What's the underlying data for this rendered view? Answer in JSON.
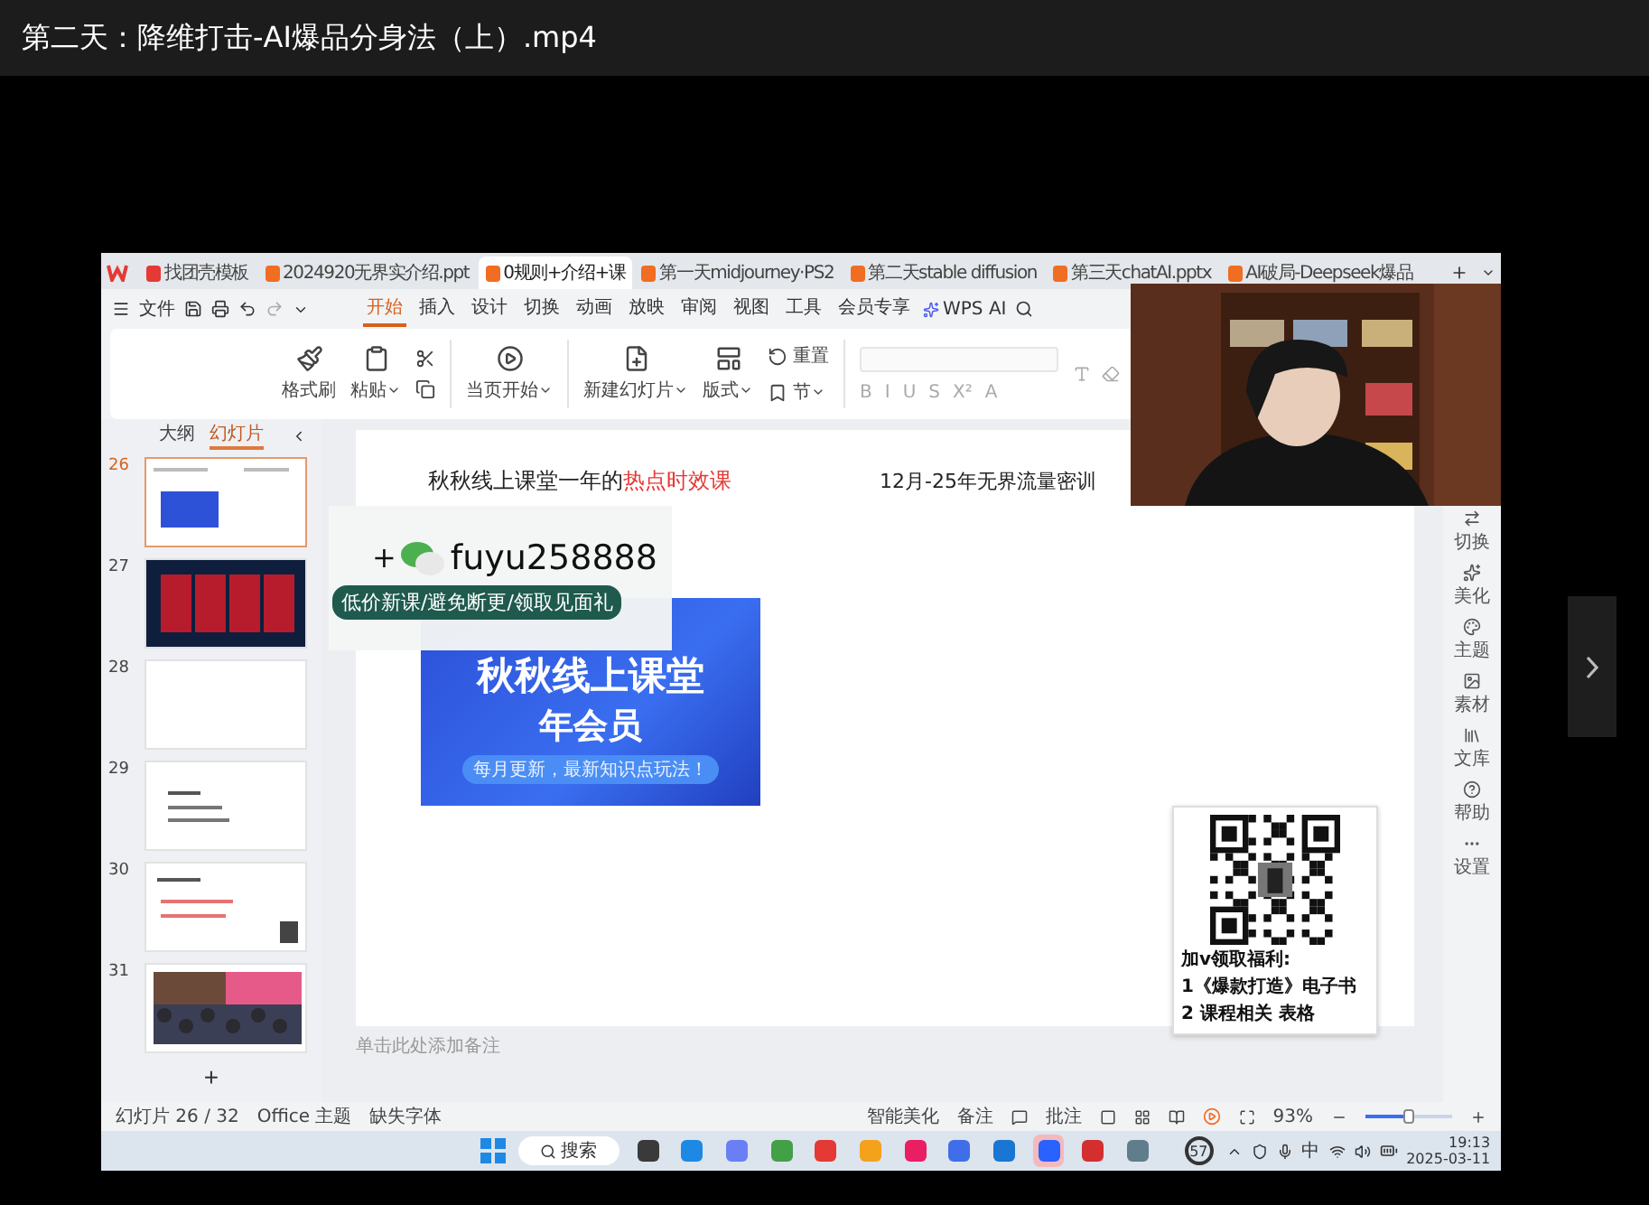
{
  "video_title": "第二天：降维打击-AI爆品分身法（上）.mp4",
  "tabs": [
    {
      "label": "找团壳模板",
      "kind": "template",
      "selected": false
    },
    {
      "label": "2024920无界实介绍.ppt",
      "kind": "ppt",
      "selected": false
    },
    {
      "label": "0规则+介绍+课",
      "kind": "ppt",
      "selected": true
    },
    {
      "label": "第一天midjourney·PS2",
      "kind": "ppt",
      "selected": false
    },
    {
      "label": "第二天stable diffusion",
      "kind": "ppt",
      "selected": false
    },
    {
      "label": "第三天chatAI.pptx",
      "kind": "ppt",
      "selected": false
    },
    {
      "label": "AI破局-Deepseek爆品",
      "kind": "ppt",
      "selected": false
    }
  ],
  "file_menu": "文件",
  "menu": [
    {
      "label": "开始",
      "selected": true
    },
    {
      "label": "插入",
      "selected": false
    },
    {
      "label": "设计",
      "selected": false
    },
    {
      "label": "切换",
      "selected": false
    },
    {
      "label": "动画",
      "selected": false
    },
    {
      "label": "放映",
      "selected": false
    },
    {
      "label": "审阅",
      "selected": false
    },
    {
      "label": "视图",
      "selected": false
    },
    {
      "label": "工具",
      "selected": false
    },
    {
      "label": "会员专享",
      "selected": false
    }
  ],
  "ai_button": "WPS AI",
  "ribbon": [
    {
      "kind": "format_painter",
      "label": "格式刷",
      "dropdown": false
    },
    {
      "kind": "paste",
      "label": "粘贴",
      "dropdown": true
    },
    {
      "kind": "play",
      "label": "当页开始",
      "dropdown": true
    },
    {
      "kind": "new_slide",
      "label": "新建幻灯片",
      "dropdown": true
    },
    {
      "kind": "layout",
      "label": "版式",
      "dropdown": true
    },
    {
      "kind": "reset",
      "label": "重置",
      "dropdown": false
    },
    {
      "kind": "section",
      "label": "节",
      "dropdown": true
    }
  ],
  "format_buttons": [
    "B",
    "I",
    "U",
    "S",
    "X²",
    "A"
  ],
  "panel_tabs": [
    {
      "label": "大纲",
      "selected": false
    },
    {
      "label": "幻灯片",
      "selected": true
    }
  ],
  "slides": [
    {
      "number": "26",
      "kind": "banner",
      "selected": true
    },
    {
      "number": "27",
      "kind": "dark",
      "selected": false
    },
    {
      "number": "28",
      "kind": "blank",
      "selected": false
    },
    {
      "number": "29",
      "kind": "list",
      "selected": false
    },
    {
      "number": "30",
      "kind": "qr",
      "selected": false
    },
    {
      "number": "31",
      "selected": false
    }
  ],
  "add_slide": "+",
  "slide": {
    "heading": "秋秋线上课堂一年的",
    "heading_highlight": "热点时效课",
    "subtitle": "12月-25年无界流量密训",
    "banner": {
      "title": "秋秋线上课堂",
      "subtitle": "年会员",
      "tagline": "每月更新，最新知识点玩法！"
    },
    "qr_lines": [
      "加v领取福利:",
      "1《爆款打造》电子书",
      "2 课程相关 表格"
    ]
  },
  "notes_placeholder": "单击此处添加备注",
  "side_tools": [
    {
      "kind": "transition",
      "label": "切换"
    },
    {
      "kind": "beautify",
      "label": "美化"
    },
    {
      "kind": "theme",
      "label": "主题"
    },
    {
      "kind": "assets",
      "label": "素材"
    },
    {
      "kind": "library",
      "label": "文库"
    },
    {
      "kind": "help",
      "label": "帮助"
    },
    {
      "kind": "settings",
      "label": "设置"
    }
  ],
  "status_bar": {
    "slide_count": "幻灯片 26 / 32",
    "theme": "Office 主题",
    "missing_font": "缺失字体",
    "beautify": "智能美化",
    "notes": "备注",
    "comments": "批注",
    "zoom": "93%",
    "level": 0.5
  },
  "overlay": {
    "plus": "+",
    "wechat_id": "fuyu258888",
    "tagline": "低价新课/避免断更/领取见面礼"
  },
  "taskbar": {
    "search": "搜索",
    "apps": [
      {
        "color": "#3a3a3a",
        "selected": false
      },
      {
        "color": "#1e88e5",
        "selected": false
      },
      {
        "color": "#6a7ff5",
        "selected": false
      },
      {
        "color": "#43a047",
        "selected": false
      },
      {
        "color": "#e53935",
        "selected": false
      },
      {
        "color": "#f4a21b",
        "selected": false
      },
      {
        "color": "#e91e63",
        "selected": false
      },
      {
        "color": "#3f6ee8",
        "selected": false
      },
      {
        "color": "#1976d2",
        "selected": false
      },
      {
        "color": "#2962ff",
        "selected": true
      },
      {
        "color": "#d32f2f",
        "selected": false
      },
      {
        "color": "#607d8b",
        "selected": false
      }
    ],
    "badge": "57",
    "ime": "中",
    "time": "19:13",
    "date": "2025-03-11"
  }
}
